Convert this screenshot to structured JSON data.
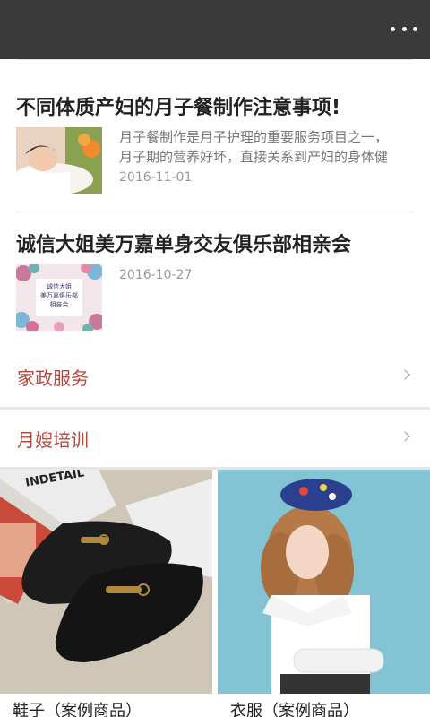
{
  "topbar": {
    "more_icon": "more-dots-icon"
  },
  "articles": [
    {
      "title": "不同体质产妇的月子餐制作注意事项!",
      "excerpt_line1": "月子餐制作是月子护理的重要服务项目之一，",
      "excerpt_line2": "月子期的营养好坏，直接关系到产妇的身体健",
      "date": "2016-11-01"
    },
    {
      "title": "诚信大姐美万嘉单身交友俱乐部相亲会",
      "thumb_text_line1": "诚信大姐",
      "thumb_text_line2": "美万嘉俱乐部",
      "thumb_text_line3": "相亲会",
      "date": "2016-10-27"
    }
  ],
  "menu": [
    {
      "label": "家政服务",
      "icon": "chevron-right-icon"
    },
    {
      "label": "月嫂培训",
      "icon": "chevron-right-icon"
    }
  ],
  "products": [
    {
      "label": "鞋子（案例商品）",
      "magazine_text": "INDETAIL"
    },
    {
      "label": "衣服（案例商品）"
    }
  ],
  "colors": {
    "accent": "#b5493d",
    "topbar": "#3a3a3a"
  }
}
